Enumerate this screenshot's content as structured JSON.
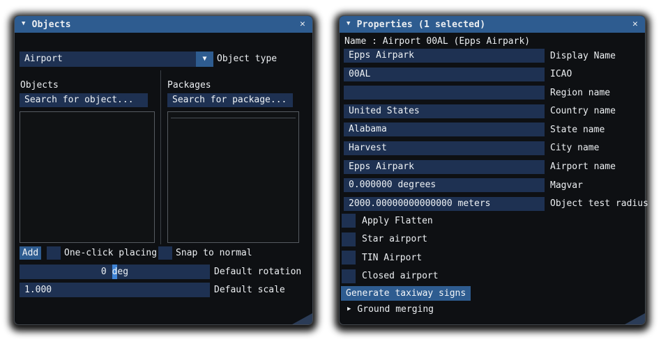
{
  "icons": {
    "triangle_down": "▼",
    "triangle_right": "▶",
    "close": "✕"
  },
  "colors": {
    "titlebar_blue": "#2e5c90",
    "field_navy": "#1e3152",
    "cursor_blue": "#3f84d6",
    "panel_bg": "#0e1013",
    "text": "#eceff2"
  },
  "objects_panel": {
    "title": "Objects",
    "object_type": {
      "value": "Airport",
      "label": "Object type"
    },
    "objects_column": {
      "label": "Objects",
      "search_placeholder": "Search for object..."
    },
    "packages_column": {
      "label": "Packages",
      "search_placeholder": "Search for package..."
    },
    "add_button": "Add",
    "one_click_label": "One-click placing",
    "snap_label": "Snap to normal",
    "rotation": {
      "value_before_cursor": "0 ",
      "cursor_char": "d",
      "value_after_cursor": "eg",
      "label": "Default rotation"
    },
    "scale": {
      "value": "1.000",
      "label": "Default scale"
    }
  },
  "properties_panel": {
    "title": "Properties (1 selected)",
    "name_line": "Name : Airport 00AL (Epps Airpark)",
    "fields": [
      {
        "value": "Epps Airpark",
        "label": "Display Name"
      },
      {
        "value": "00AL",
        "label": "ICAO"
      },
      {
        "value": "",
        "label": "Region name"
      },
      {
        "value": "United States",
        "label": "Country name"
      },
      {
        "value": "Alabama",
        "label": "State name"
      },
      {
        "value": "Harvest",
        "label": "City name"
      },
      {
        "value": "Epps Airpark",
        "label": "Airport name"
      },
      {
        "value": "0.000000 degrees",
        "label": "Magvar"
      },
      {
        "value": "2000.00000000000000 meters",
        "label": "Object test radius"
      }
    ],
    "checkboxes": [
      {
        "label": "Apply Flatten"
      },
      {
        "label": "Star airport"
      },
      {
        "label": "TIN Airport"
      },
      {
        "label": "Closed airport"
      }
    ],
    "generate_button": "Generate taxiway signs",
    "ground_merging_label": "Ground merging"
  }
}
